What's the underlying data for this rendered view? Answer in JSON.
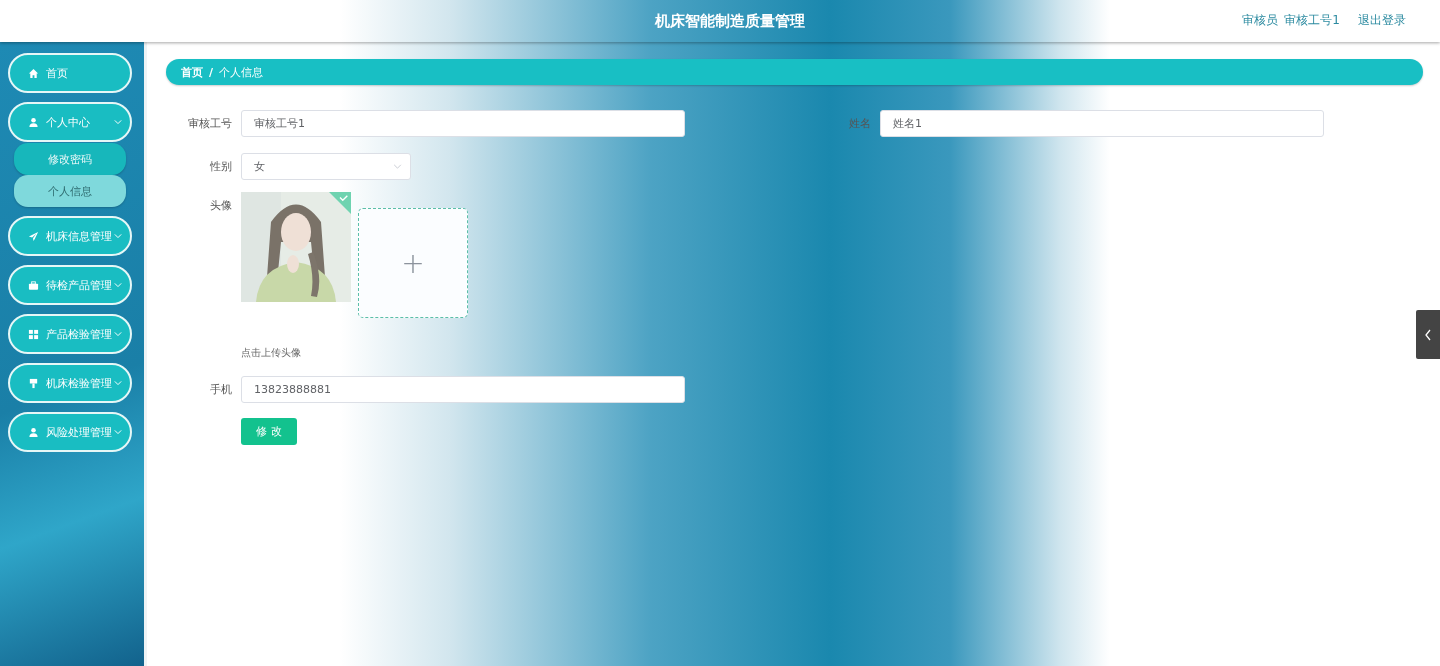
{
  "header": {
    "title": "机床智能制造质量管理",
    "role": "审核员",
    "username": "审核工号1",
    "logout": "退出登录"
  },
  "sidebar": {
    "items": [
      {
        "label": "首页"
      },
      {
        "label": "个人中心",
        "children": [
          {
            "label": "修改密码",
            "selected": false
          },
          {
            "label": "个人信息",
            "selected": true
          }
        ]
      },
      {
        "label": "机床信息管理"
      },
      {
        "label": "待检产品管理"
      },
      {
        "label": "产品检验管理"
      },
      {
        "label": "机床检验管理"
      },
      {
        "label": "风险处理管理"
      }
    ]
  },
  "breadcrumb": [
    "首页",
    "/",
    "个人信息"
  ],
  "form": {
    "fields": [
      {
        "label": "审核工号",
        "value": "审核工号1",
        "kind": "text"
      },
      {
        "label": "姓名",
        "value": "姓名1",
        "kind": "text"
      },
      {
        "label": "性别",
        "value": "女",
        "kind": "select"
      },
      {
        "label": "头像",
        "kind": "upload",
        "hint": "点击上传头像",
        "upload_symbol": "+"
      },
      {
        "label": "手机",
        "value": "13823888881",
        "kind": "text"
      }
    ],
    "submit": "修 改"
  }
}
